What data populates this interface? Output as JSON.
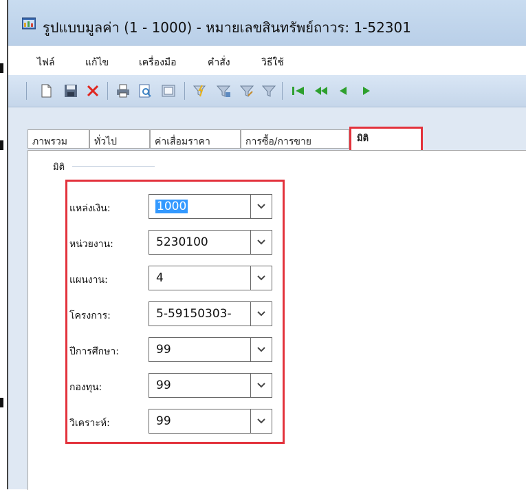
{
  "window": {
    "title": "รูปแบบมูลค่า (1 - 1000) - หมายเลขสินทรัพย์ถาวร: 1-52301"
  },
  "menu": {
    "items": [
      "ไฟล์",
      "แก้ไข",
      "เครื่องมือ",
      "คำสั่ง",
      "วิธีใช้"
    ]
  },
  "toolbar": {
    "icons": [
      "new-document-icon",
      "save-icon",
      "delete-icon",
      "print-icon",
      "print-preview-icon",
      "export-excel-icon",
      "filter-by-selection-icon",
      "filter-icon",
      "advanced-filter-icon",
      "remove-filter-icon",
      "first-record-icon",
      "previous-page-icon",
      "previous-record-icon",
      "next-record-icon"
    ]
  },
  "tabs": [
    {
      "label": "ภาพรวม",
      "active": false
    },
    {
      "label": "ทั่วไป",
      "active": false
    },
    {
      "label": "ค่าเสื่อมราคา",
      "active": false
    },
    {
      "label": "การซื้อ/การขาย",
      "active": false
    },
    {
      "label": "มิติ",
      "active": true
    }
  ],
  "dimensions": {
    "group_title": "มิติ",
    "fields": [
      {
        "label": "แหล่งเงิน:",
        "value": "1000",
        "selected": true
      },
      {
        "label": "หน่วยงาน:",
        "value": "5230100",
        "selected": false
      },
      {
        "label": "แผนงาน:",
        "value": "4",
        "selected": false
      },
      {
        "label": "โครงการ:",
        "value": "5-59150303-",
        "selected": false
      },
      {
        "label": "ปีการศึกษา:",
        "value": "99",
        "selected": false
      },
      {
        "label": "กองทุน:",
        "value": "99",
        "selected": false
      },
      {
        "label": "วิเคราะห์:",
        "value": "99",
        "selected": false
      }
    ]
  },
  "colors": {
    "highlight": "#e3323c",
    "selection": "#3399ff"
  }
}
